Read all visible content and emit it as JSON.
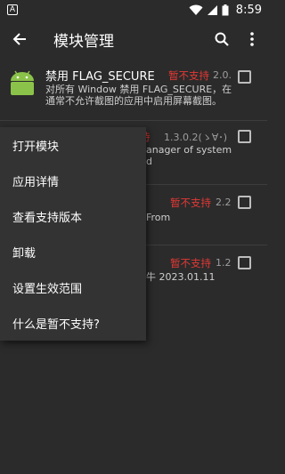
{
  "status_bar": {
    "a_icon": "A",
    "time": "8:59",
    "icons": [
      "wifi-icon",
      "signal-icon",
      "battery-icon"
    ]
  },
  "app_bar": {
    "title": "模块管理",
    "icons": [
      "back-arrow-icon",
      "search-icon",
      "more-vert-icon"
    ]
  },
  "modules": [
    {
      "name": "禁用 FLAG_SECURE",
      "status": "暂不支持",
      "version": "2.0.",
      "description": "对所有 Window 禁用 FLAG_SECURE，在通常不允许截图的应用中启用屏幕截图。",
      "checked": false
    },
    {
      "name": "",
      "status": "持",
      "version": "1.3.0.2(ゝ∀･)",
      "description_lines": [
        "anager of system",
        "d"
      ],
      "checked": false
    },
    {
      "name": "",
      "status": "暂不支持",
      "version": "2.2",
      "description_lines": [
        "From"
      ],
      "checked": false
    },
    {
      "name": "",
      "status": "暂不支持",
      "version": "1.2",
      "description_lines": [
        "牛 2023.01.11"
      ],
      "checked": false
    }
  ],
  "menu": {
    "items": [
      "打开模块",
      "应用详情",
      "查看支持版本",
      "卸载",
      "设置生效范围",
      "什么是暂不支持?"
    ]
  },
  "colors": {
    "background": "#2b2b2b",
    "menu_background": "#333333",
    "status_red": "#e53935",
    "android_green": "#8bc34a"
  }
}
